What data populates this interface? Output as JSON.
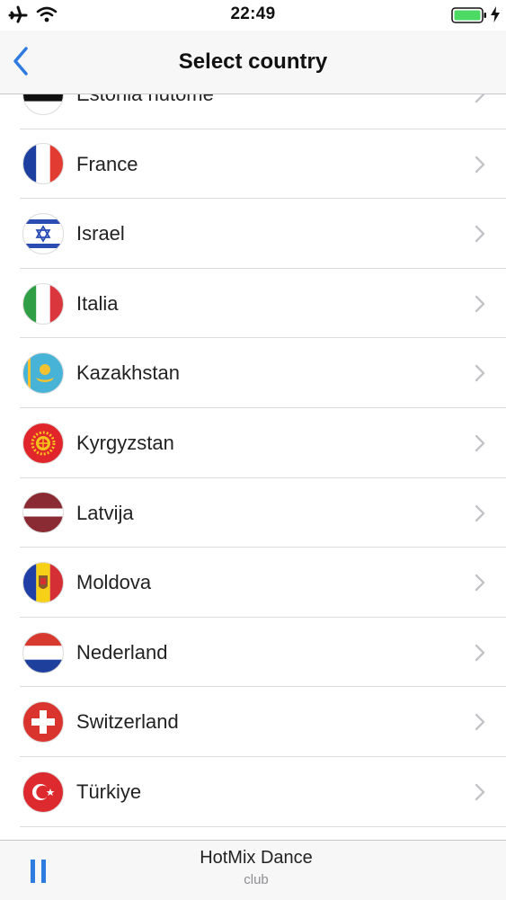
{
  "status_bar": {
    "time": "22:49",
    "icons": [
      "airplane-icon",
      "wifi-icon",
      "battery-icon",
      "charging-bolt-icon"
    ]
  },
  "nav": {
    "title": "Select country",
    "back_icon": "chevron-left-icon"
  },
  "countries": [
    {
      "id": "estonia",
      "label": "Estonia nutome",
      "flag_icon": "estonia-flag-icon"
    },
    {
      "id": "france",
      "label": "France",
      "flag_icon": "france-flag-icon"
    },
    {
      "id": "israel",
      "label": "Israel",
      "flag_icon": "israel-flag-icon"
    },
    {
      "id": "italia",
      "label": "Italia",
      "flag_icon": "italy-flag-icon"
    },
    {
      "id": "kazakhstan",
      "label": "Kazakhstan",
      "flag_icon": "kazakhstan-flag-icon"
    },
    {
      "id": "kyrgyzstan",
      "label": "Kyrgyzstan",
      "flag_icon": "kyrgyzstan-flag-icon"
    },
    {
      "id": "latvija",
      "label": "Latvija",
      "flag_icon": "latvia-flag-icon"
    },
    {
      "id": "moldova",
      "label": "Moldova",
      "flag_icon": "moldova-flag-icon"
    },
    {
      "id": "nederland",
      "label": "Nederland",
      "flag_icon": "netherlands-flag-icon"
    },
    {
      "id": "switzerland",
      "label": "Switzerland",
      "flag_icon": "switzerland-flag-icon"
    },
    {
      "id": "turkiye",
      "label": "Türkiye",
      "flag_icon": "turkey-flag-icon"
    }
  ],
  "player": {
    "station": "HotMix Dance",
    "subtitle": "club",
    "control_icon": "pause-icon"
  },
  "colors": {
    "accent": "#2f7ce0",
    "battery": "#4cd964",
    "separator": "#dcdcdf",
    "chevron": "#c4c4c8"
  }
}
